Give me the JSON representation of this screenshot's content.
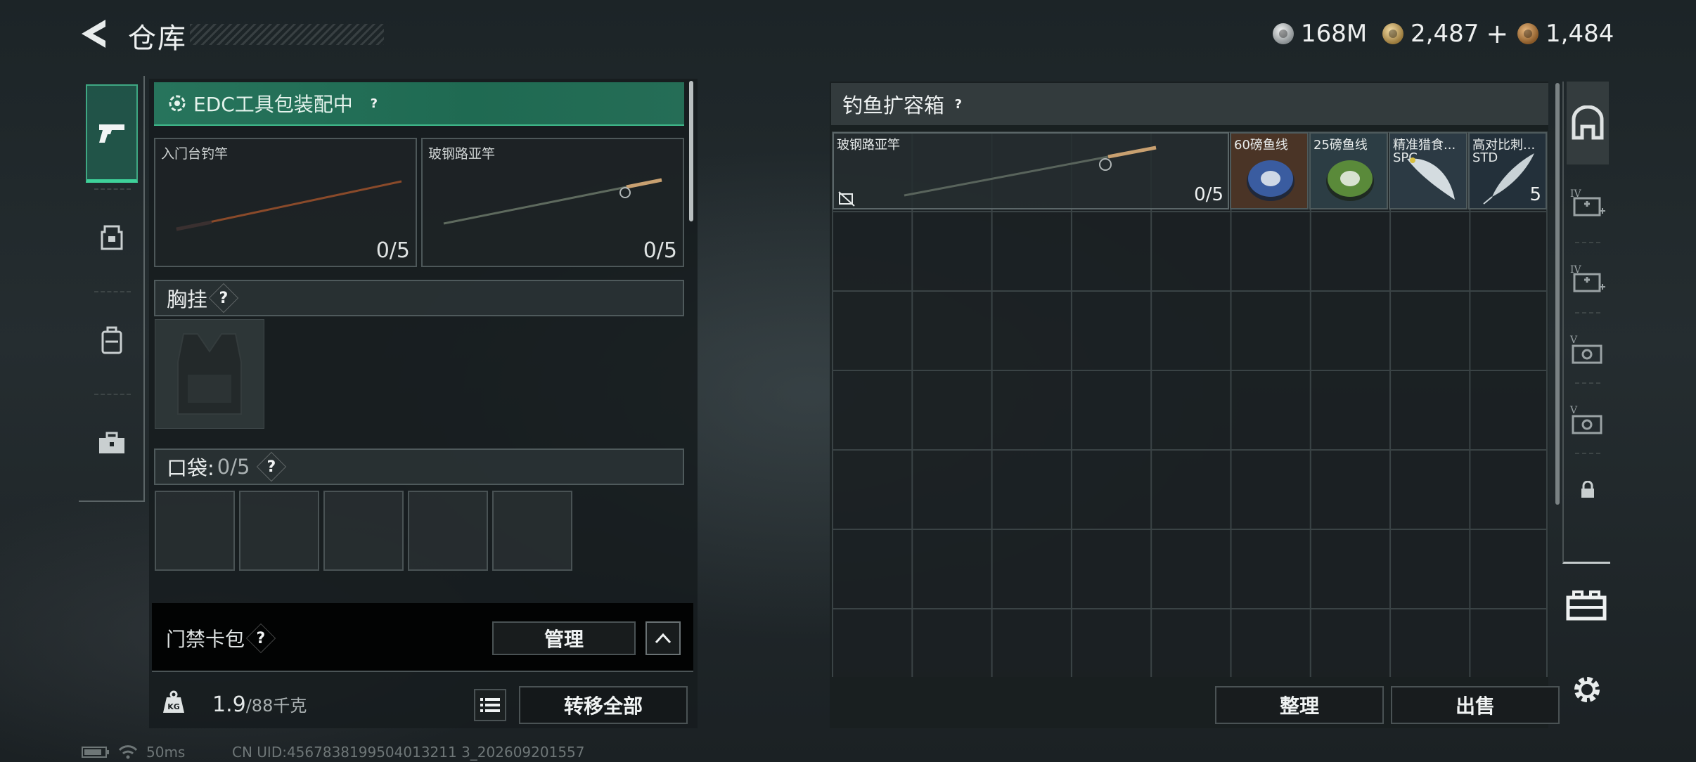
{
  "header": {
    "title": "仓库",
    "currencies": [
      {
        "name": "silver-coin",
        "value": "168M"
      },
      {
        "name": "gold-coin",
        "value": "2,487",
        "plus": "+"
      },
      {
        "name": "bronze-coin",
        "value": "1,484"
      }
    ]
  },
  "left_nav": {
    "items": [
      {
        "icon": "pistol-icon",
        "active": true
      },
      {
        "icon": "helmet-armor-icon",
        "active": false
      },
      {
        "icon": "backpack-icon",
        "active": false
      },
      {
        "icon": "toolbox-icon",
        "active": false
      }
    ]
  },
  "loadout": {
    "edc_status": "EDC工具包装配中",
    "help": "?",
    "rod_slots": [
      {
        "name": "入门台钓竿",
        "count": "0/5"
      },
      {
        "name": "玻钢路亚竿",
        "count": "0/5"
      }
    ],
    "chest_rig": {
      "label": "胸挂",
      "help": "?"
    },
    "pockets": {
      "label": "口袋:",
      "count": "0/5",
      "help": "?"
    },
    "card_pack": {
      "label": "门禁卡包",
      "help": "?",
      "manage_label": "管理"
    },
    "weight": {
      "current": "1.9",
      "max": "/88千克"
    },
    "transfer_all_label": "转移全部"
  },
  "container": {
    "title": "钓鱼扩容箱",
    "help": "?",
    "items": [
      {
        "name": "玻钢路亚竿",
        "count": "0/5",
        "bg": "#2a3234"
      },
      {
        "name": "60磅鱼线",
        "sub": "",
        "qty": "",
        "bg": "#4a3426"
      },
      {
        "name": "25磅鱼线",
        "sub": "",
        "qty": "",
        "bg": "#2c3d44"
      },
      {
        "name": "精准猎食...",
        "sub": "SPC",
        "qty": "",
        "bg": "#2c3a44"
      },
      {
        "name": "高对比刺...",
        "sub": "STD",
        "qty": "5",
        "bg": "#23303a"
      }
    ],
    "sort_label": "整理",
    "sell_label": "出售"
  },
  "right_tabs": [
    {
      "icon": "safe-box-icon",
      "tier": ""
    },
    {
      "icon": "medkit-icon",
      "tier": "IV"
    },
    {
      "icon": "medkit-icon",
      "tier": "IV"
    },
    {
      "icon": "ammo-box-icon",
      "tier": "V"
    },
    {
      "icon": "ammo-box-icon",
      "tier": "V"
    },
    {
      "icon": "lock-icon",
      "tier": ""
    }
  ],
  "status_bar": {
    "ping": "50ms",
    "uid": "CN UID:4567838199504013211 3_202609201557"
  },
  "colors": {
    "accent_green": "#3ed29a",
    "edc_bar": "#27745c",
    "panel": "#1c2224"
  }
}
